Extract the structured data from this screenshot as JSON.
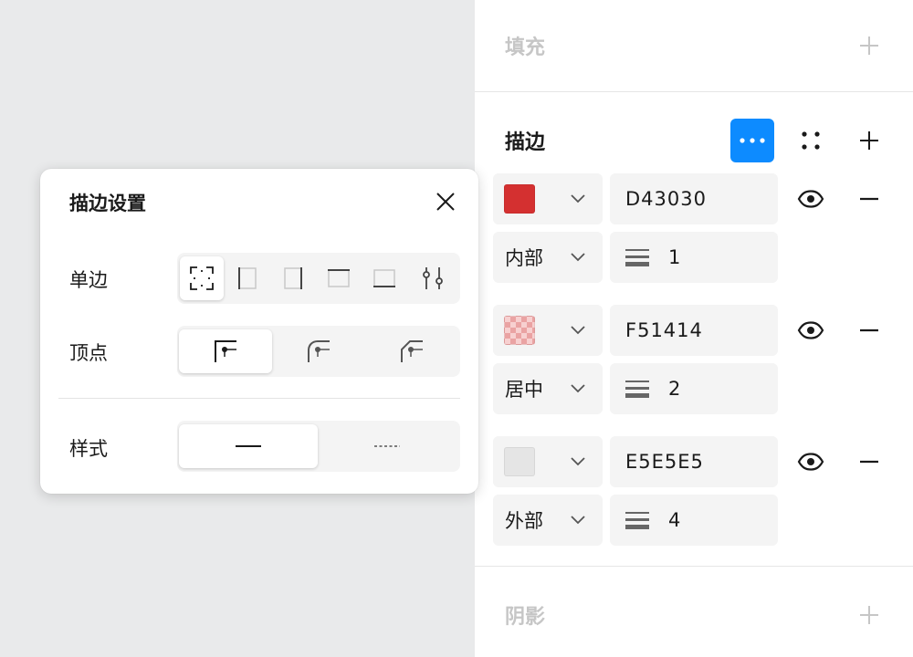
{
  "fill": {
    "title": "填充",
    "add_icon": "plus-icon"
  },
  "stroke": {
    "title": "描边",
    "more_icon": "more-horizontal-icon",
    "grid_icon": "four-dots-icon",
    "add_icon": "plus-icon",
    "rows": [
      {
        "hex": "D43030",
        "swatch_color": "#d43030",
        "position": "内部",
        "weight": "1"
      },
      {
        "hex": "F51414",
        "swatch_color": "#f51414",
        "swatch_style": "checker",
        "position": "居中",
        "weight": "2"
      },
      {
        "hex": "E5E5E5",
        "swatch_color": "#e5e5e5",
        "position": "外部",
        "weight": "4"
      }
    ]
  },
  "shadow": {
    "title": "阴影",
    "add_icon": "plus-icon"
  },
  "popover": {
    "title": "描边设置",
    "close_icon": "close-icon",
    "single_side": {
      "label": "单边",
      "options": [
        "all-sides-icon",
        "left-side-icon",
        "right-side-icon",
        "top-side-icon",
        "bottom-side-icon",
        "custom-sliders-icon"
      ],
      "selected": 0
    },
    "corner": {
      "label": "顶点",
      "options": [
        "corner-miter-icon",
        "corner-round-icon",
        "corner-bevel-icon"
      ],
      "selected": 0
    },
    "style": {
      "label": "样式",
      "options": [
        "solid-line",
        "dashed-line"
      ],
      "selected": 0
    }
  },
  "colors": {
    "accent": "#0d8bff",
    "panel_bg": "#ffffff",
    "canvas_bg": "#e9eaeb",
    "field_bg": "#f4f4f4"
  }
}
